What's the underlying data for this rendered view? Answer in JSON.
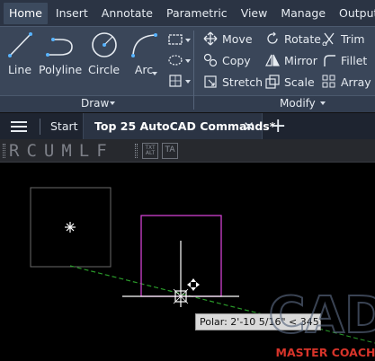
{
  "menu": {
    "tabs": [
      "Home",
      "Insert",
      "Annotate",
      "Parametric",
      "View",
      "Manage",
      "Output"
    ],
    "active": "Home"
  },
  "ribbon": {
    "draw": {
      "label": "Draw",
      "tools": {
        "line": "Line",
        "polyline": "Polyline",
        "circle": "Circle",
        "arc": "Arc"
      }
    },
    "modify": {
      "label": "Modify",
      "col1": [
        "Move",
        "Copy",
        "Stretch"
      ],
      "col2": [
        "Rotate",
        "Mirror",
        "Scale"
      ],
      "col3": [
        "Trim",
        "Fillet",
        "Array"
      ]
    }
  },
  "file_tabs": {
    "start": "Start",
    "active_doc": "Top 25 AutoCAD Commands*",
    "close_glyph": "✕",
    "add_glyph": "+"
  },
  "toolbar": {
    "letters": "RCUMLF",
    "text_tool_line1": "TXT",
    "text_tool_line2": "ALT",
    "text_tool2": "TA"
  },
  "canvas": {
    "tooltip": "Polar: 2'-10 5/16\" < 345°",
    "watermark_line1": "CAD",
    "watermark_line2": "MASTER COACH"
  },
  "colors": {
    "ribbon_bg": "#3a4659",
    "menu_bg": "#2b3444",
    "canvas_bg": "#000000",
    "selected_square": "#d040d0",
    "polar_track": "#2a9a2a"
  }
}
